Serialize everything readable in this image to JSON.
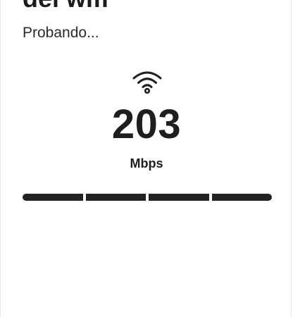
{
  "header": {
    "title": "del wifi"
  },
  "test": {
    "status": "Probando...",
    "speed_value": "203",
    "speed_unit": "Mbps",
    "icon": "wifi-icon",
    "progress_segments_total": 4,
    "progress_segments_filled": 4,
    "progress_fraction": 1.0
  },
  "colors": {
    "text": "#1e1e1e",
    "progress_filled": "#222222",
    "background": "#ffffff"
  }
}
